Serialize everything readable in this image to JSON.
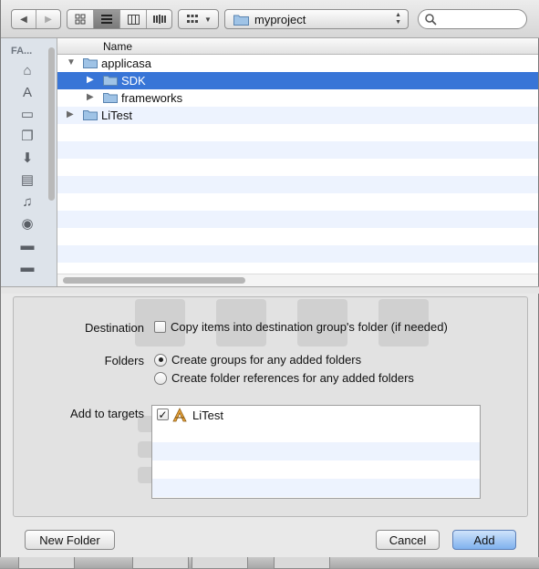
{
  "toolbar": {
    "location": "myproject"
  },
  "sidebar": {
    "header": "FA...",
    "items": [
      {
        "icon": "home-icon",
        "glyph": "⌂"
      },
      {
        "icon": "applications-icon",
        "glyph": "A"
      },
      {
        "icon": "desktop-icon",
        "glyph": "▭"
      },
      {
        "icon": "documents-icon",
        "glyph": "❐"
      },
      {
        "icon": "downloads-icon",
        "glyph": "⬇"
      },
      {
        "icon": "movies-icon",
        "glyph": "▤"
      },
      {
        "icon": "music-icon",
        "glyph": "♫"
      },
      {
        "icon": "pictures-icon",
        "glyph": "◉"
      },
      {
        "icon": "folder-icon",
        "glyph": "▬"
      },
      {
        "icon": "folder-icon",
        "glyph": "▬"
      }
    ]
  },
  "filelist": {
    "column_name": "Name",
    "rows": [
      {
        "name": "applicasa",
        "expanded": true,
        "indent": 0
      },
      {
        "name": "SDK",
        "expanded": false,
        "indent": 1,
        "selected": true
      },
      {
        "name": "frameworks",
        "expanded": false,
        "indent": 1
      },
      {
        "name": "LiTest",
        "expanded": false,
        "indent": 0
      }
    ]
  },
  "options": {
    "destination_label": "Destination",
    "copy_items": "Copy items into destination group's folder (if needed)",
    "copy_checked": false,
    "folders_label": "Folders",
    "create_groups": "Create groups for any added folders",
    "create_references": "Create folder references for any added folders",
    "targets_label": "Add to targets",
    "targets": [
      {
        "name": "LiTest",
        "checked": true
      }
    ]
  },
  "buttons": {
    "new_folder": "New Folder",
    "cancel": "Cancel",
    "add": "Add"
  },
  "colors": {
    "selection": "#3875d7",
    "alt_row": "#edf3fe"
  }
}
